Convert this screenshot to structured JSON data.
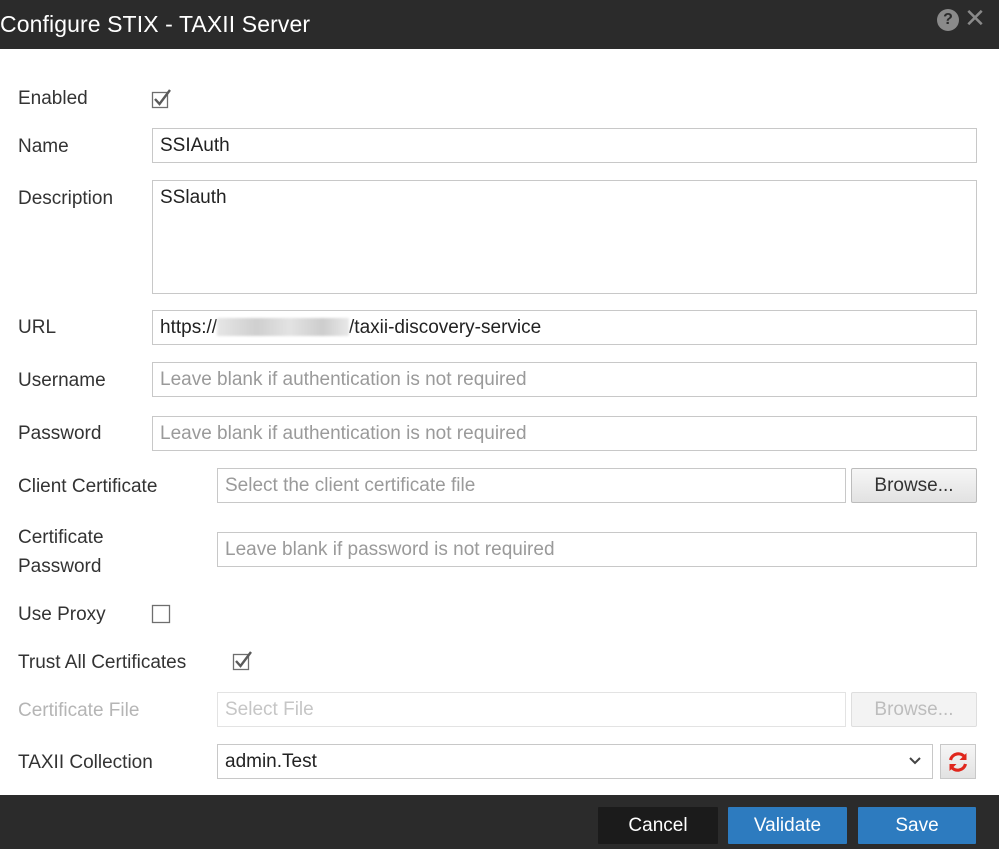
{
  "dialog": {
    "title": "Configure STIX - TAXII Server"
  },
  "form": {
    "enabled_label": "Enabled",
    "enabled_checked": true,
    "name_label": "Name",
    "name_value": "SSIAuth",
    "description_label": "Description",
    "description_value": "SSlauth",
    "url_label": "URL",
    "url_prefix": "https://",
    "url_suffix": "/taxii-discovery-service",
    "username_label": "Username",
    "username_placeholder": "Leave blank if authentication is not required",
    "password_label": "Password",
    "password_placeholder": "Leave blank if authentication is not required",
    "client_cert_label": "Client Certificate",
    "client_cert_placeholder": "Select the client certificate file",
    "browse_label": "Browse...",
    "cert_password_label_line1": "Certificate",
    "cert_password_label_line2": "Password",
    "cert_password_placeholder": "Leave blank if password is not required",
    "use_proxy_label": "Use Proxy",
    "use_proxy_checked": false,
    "trust_all_label": "Trust All Certificates",
    "trust_all_checked": true,
    "cert_file_label": "Certificate File",
    "cert_file_placeholder": "Select File",
    "cert_file_browse_label": "Browse...",
    "taxii_collection_label": "TAXII Collection",
    "taxii_collection_value": "admin.Test"
  },
  "footer": {
    "cancel_label": "Cancel",
    "validate_label": "Validate",
    "save_label": "Save"
  },
  "icons": {
    "help": "help-icon",
    "close": "close-icon",
    "checkmark": "checkmark-icon",
    "chevron": "chevron-down-icon",
    "refresh": "refresh-icon"
  },
  "colors": {
    "titlebar_bg": "#2b2b2b",
    "primary_button": "#2d7bbf",
    "cancel_button": "#1b1b1b",
    "refresh_icon": "#e0261c"
  }
}
